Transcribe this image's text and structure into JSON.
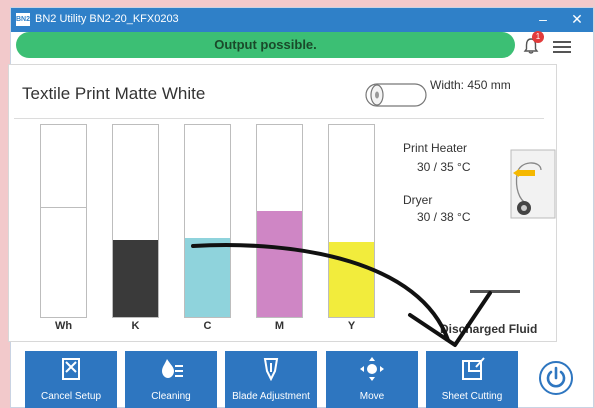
{
  "titlebar": {
    "logo": "BN2",
    "title": "BN2 Utility   BN2-20_KFX0203",
    "minimize": "–",
    "close": "✕"
  },
  "status": {
    "text": "Output possible.",
    "color": "#3cbf74",
    "notification_count": "1",
    "bell_icon": "bell-icon",
    "menu_icon": "hamburger-menu-icon"
  },
  "media": {
    "name": "Textile Print Matte White",
    "width_text": "Width: 450 mm",
    "roll_icon": "media-roll-icon"
  },
  "ink_tanks": [
    {
      "label": "Wh",
      "level": 0.57,
      "color": "#ffffff"
    },
    {
      "label": "K",
      "level": 0.4,
      "color": "#3a3a3a"
    },
    {
      "label": "C",
      "level": 0.41,
      "color": "#8fd3dc"
    },
    {
      "label": "M",
      "level": 0.55,
      "color": "#cf86c5"
    },
    {
      "label": "Y",
      "level": 0.39,
      "color": "#f2ec3c"
    }
  ],
  "heater": {
    "print_heater_label": "Print Heater",
    "print_heater_value": "30 / 35 °C",
    "dryer_label": "Dryer",
    "dryer_value": "30 / 38 °C",
    "icon": "printer-heater-icon"
  },
  "waste": {
    "label": "Discharged Fluid",
    "level": 0.05
  },
  "bottom_buttons": [
    {
      "label": "Cancel Setup",
      "icon": "cancel-setup-icon"
    },
    {
      "label": "Cleaning",
      "icon": "cleaning-icon"
    },
    {
      "label": "Blade Adjustment",
      "icon": "blade-adjustment-icon"
    },
    {
      "label": "Move",
      "icon": "move-icon"
    },
    {
      "label": "Sheet Cutting",
      "icon": "sheet-cutting-icon"
    }
  ],
  "power_icon": "power-icon",
  "accent_color": "#2e76c0"
}
